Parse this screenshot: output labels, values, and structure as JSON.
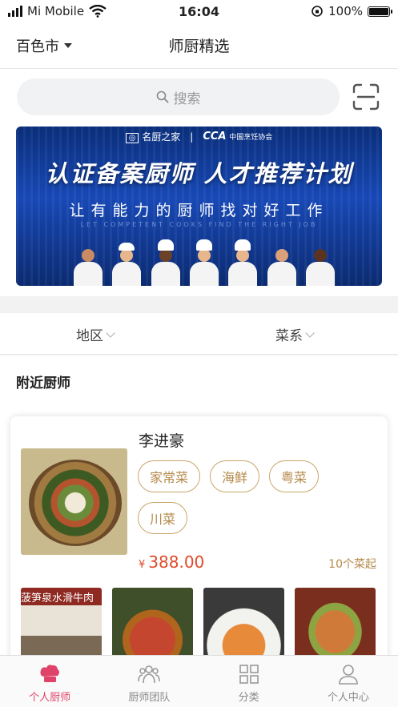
{
  "status_bar": {
    "carrier": "Mi Mobile",
    "time": "16:04",
    "battery": "100%",
    "battery_level": 1.0
  },
  "header": {
    "city": "百色市",
    "title": "师厨精选"
  },
  "search": {
    "placeholder": "搜索"
  },
  "banner": {
    "logo_left": "名厨之家",
    "logo_right_mark": "CCA",
    "logo_right": "中国烹饪协会",
    "headline": "认证备案厨师 人才推荐计划",
    "subline": "让有能力的厨师找对好工作",
    "subline_en": "LET COMPETENT COOKS FIND THE RIGHT JOB"
  },
  "filters": {
    "region": "地区",
    "cuisine": "菜系"
  },
  "section": {
    "nearby_title": "附近厨师"
  },
  "chef_card": {
    "name": "李进豪",
    "tags": [
      "家常菜",
      "海鲜",
      "粤菜",
      "川菜"
    ],
    "currency": "¥",
    "price": "388.00",
    "min_order": "10个菜起",
    "dish_1_label": "菠笋泉水滑牛肉"
  },
  "tabbar": {
    "items": [
      {
        "label": "个人厨师",
        "icon": "chef-hat-icon",
        "active": true
      },
      {
        "label": "厨师团队",
        "icon": "team-icon",
        "active": false
      },
      {
        "label": "分类",
        "icon": "grid-icon",
        "active": false
      },
      {
        "label": "个人中心",
        "icon": "user-icon",
        "active": false
      }
    ]
  },
  "colors": {
    "accent": "#e0436a",
    "tag": "#b58a4a",
    "price": "#e04a2a",
    "banner": "#1748b6"
  }
}
